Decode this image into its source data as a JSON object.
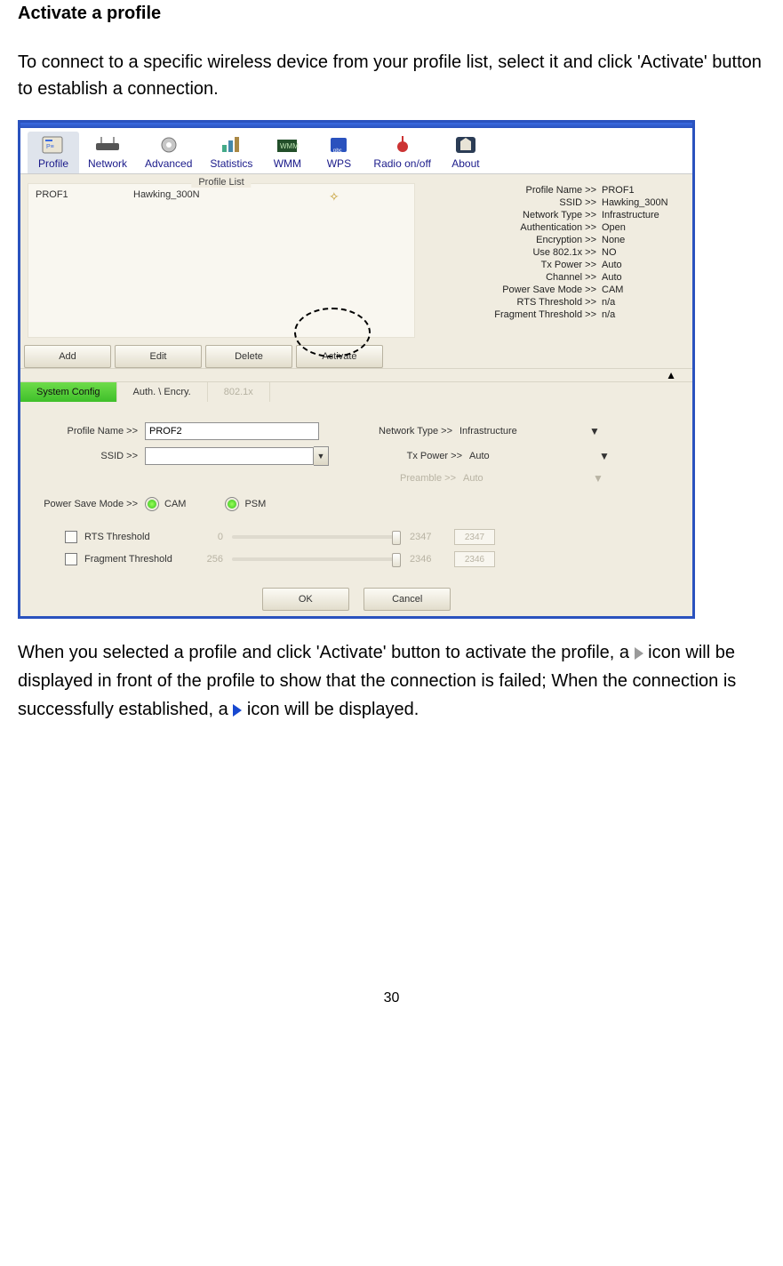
{
  "doc": {
    "heading": "Activate a profile",
    "para1": "To connect to a specific wireless device from your profile list,    select it and click 'Activate' button to establish a connection.",
    "para2_a": "When you selected a profile and click 'Activate' button to activate the profile, a ",
    "para2_b": " icon will be displayed in front of the profile to show that the connection is failed; When the connection is successfully established, a ",
    "para2_c": " icon will be displayed.",
    "page_num": "30"
  },
  "toolbar": {
    "items": [
      {
        "label": "Profile"
      },
      {
        "label": "Network"
      },
      {
        "label": "Advanced"
      },
      {
        "label": "Statistics"
      },
      {
        "label": "WMM"
      },
      {
        "label": "WPS"
      },
      {
        "label": "Radio on/off"
      },
      {
        "label": "About"
      }
    ]
  },
  "profile_list": {
    "title": "Profile List",
    "rows": [
      {
        "name": "PROF1",
        "ssid": "Hawking_300N"
      }
    ],
    "buttons": {
      "add": "Add",
      "edit": "Edit",
      "delete": "Delete",
      "activate": "Activate"
    }
  },
  "details": {
    "profile_name": {
      "label": "Profile Name >>",
      "value": "PROF1"
    },
    "ssid": {
      "label": "SSID >>",
      "value": "Hawking_300N"
    },
    "network_type": {
      "label": "Network Type >>",
      "value": "Infrastructure"
    },
    "auth": {
      "label": "Authentication >>",
      "value": "Open"
    },
    "encryption": {
      "label": "Encryption >>",
      "value": "None"
    },
    "use8021x": {
      "label": "Use 802.1x >>",
      "value": "NO"
    },
    "tx_power": {
      "label": "Tx Power >>",
      "value": "Auto"
    },
    "channel": {
      "label": "Channel >>",
      "value": "Auto"
    },
    "psm": {
      "label": "Power Save Mode >>",
      "value": "CAM"
    },
    "rts": {
      "label": "RTS Threshold >>",
      "value": "n/a"
    },
    "frag": {
      "label": "Fragment Threshold >>",
      "value": "n/a"
    }
  },
  "tabs2": {
    "system": "System Config",
    "auth": "Auth. \\ Encry.",
    "x8021": "802.1x"
  },
  "config": {
    "profile_name": {
      "label": "Profile Name >>",
      "value": "PROF2"
    },
    "ssid": {
      "label": "SSID >>",
      "value": ""
    },
    "network_type": {
      "label": "Network Type >>",
      "value": "Infrastructure"
    },
    "tx_power": {
      "label": "Tx Power >>",
      "value": "Auto"
    },
    "preamble": {
      "label": "Preamble >>",
      "value": "Auto"
    },
    "psm": {
      "label": "Power Save Mode >>",
      "cam": "CAM",
      "psm": "PSM"
    },
    "rts": {
      "label": "RTS Threshold",
      "min": "0",
      "max": "2347",
      "val": "2347"
    },
    "frag": {
      "label": "Fragment Threshold",
      "min": "256",
      "max": "2346",
      "val": "2346"
    },
    "ok": "OK",
    "cancel": "Cancel"
  }
}
